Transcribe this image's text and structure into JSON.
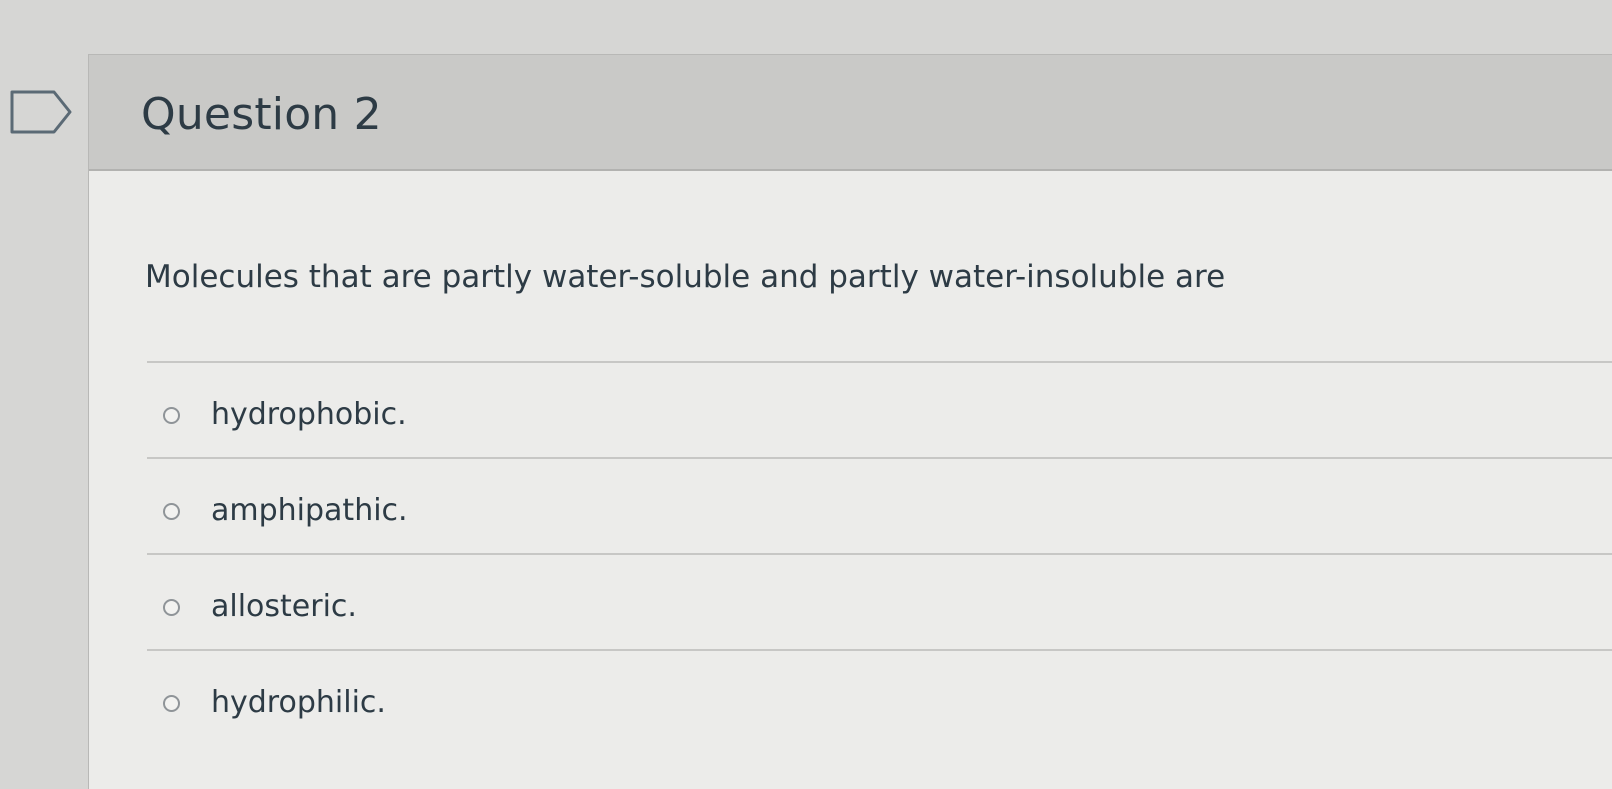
{
  "question": {
    "title": "Question 2",
    "text": "Molecules that are partly water-soluble and partly water-insoluble are",
    "answers": [
      {
        "label": "hydrophobic."
      },
      {
        "label": "amphipathic."
      },
      {
        "label": "allosteric."
      },
      {
        "label": "hydrophilic."
      }
    ]
  },
  "icons": {
    "flag": "bookmark-flag-icon",
    "radio": "radio-unselected-icon"
  },
  "colors": {
    "text": "#2d3b45",
    "header_bg": "#c9c9c7",
    "card_bg": "#ececea",
    "page_bg": "#d6d6d4"
  }
}
